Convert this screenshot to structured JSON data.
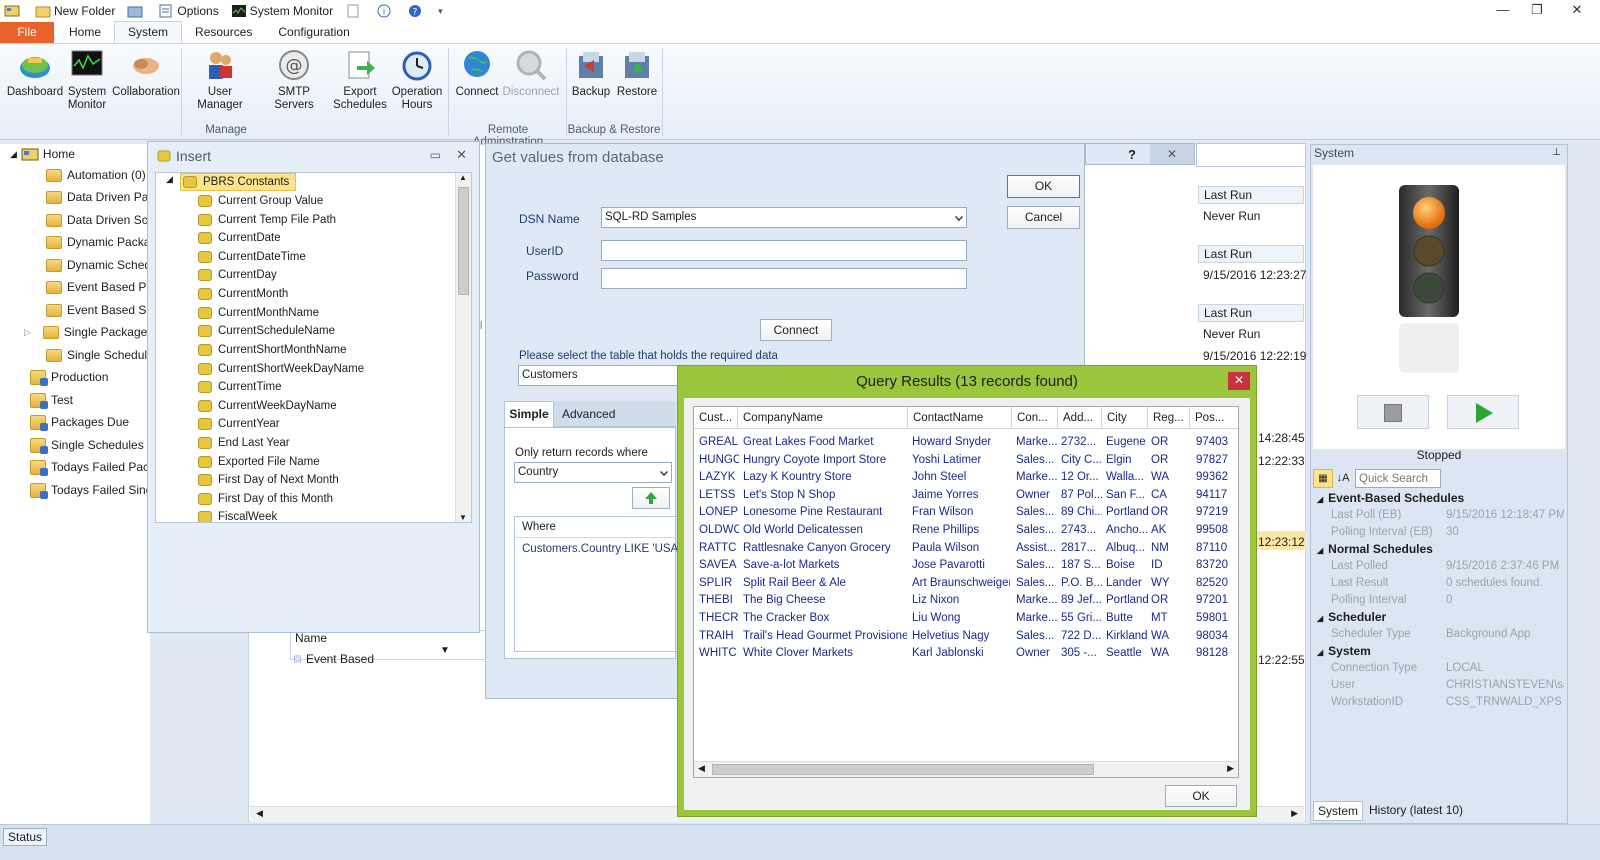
{
  "qat": {
    "new_folder": "New Folder",
    "options": "Options",
    "system_monitor": "System Monitor"
  },
  "tabs": [
    "File",
    "Home",
    "System",
    "Resources",
    "Configuration"
  ],
  "ribbon": {
    "buttons": [
      {
        "label": "Dashboard",
        "icon": "dashboard-icon"
      },
      {
        "label": "System\nMonitor",
        "icon": "system-monitor-icon"
      },
      {
        "label": "Collaboration",
        "icon": "collaboration-icon"
      },
      {
        "label": "User Manager",
        "icon": "user-manager-icon"
      },
      {
        "label": "SMTP Servers",
        "icon": "smtp-icon"
      },
      {
        "label": "Export\nSchedules",
        "icon": "export-icon"
      },
      {
        "label": "Operation\nHours",
        "icon": "clock-icon"
      },
      {
        "label": "Connect",
        "icon": "connect-icon"
      },
      {
        "label": "Disconnect",
        "icon": "disconnect-icon"
      },
      {
        "label": "Backup",
        "icon": "backup-icon"
      },
      {
        "label": "Restore",
        "icon": "restore-icon"
      }
    ],
    "groups": [
      "Manage",
      "Remote Adminstration",
      "Backup & Restore"
    ]
  },
  "tree": {
    "root": "Home",
    "items": [
      "Automation (0)",
      "Data Driven Pack",
      "Data Driven Sche",
      "Dynamic Packag",
      "Dynamic Schedu",
      "Event Based Pac",
      "Event Based Sch",
      "Single Packages",
      "Single Schedules",
      "Production",
      "Test",
      "Packages Due",
      "Single Schedules Du",
      "Todays Failed Packa",
      "Todays Failed Singl"
    ]
  },
  "insert": {
    "title": "Insert",
    "root": "PBRS Constants",
    "items": [
      "Current Group Value",
      "Current Temp File Path",
      "CurrentDate",
      "CurrentDateTime",
      "CurrentDay",
      "CurrentMonth",
      "CurrentMonthName",
      "CurrentScheduleName",
      "CurrentShortMonthName",
      "CurrentShortWeekDayName",
      "CurrentTime",
      "CurrentWeekDayName",
      "CurrentYear",
      "End Last Year",
      "Exported File Name",
      "First Day of Next Month",
      "First Day of this Month",
      "FiscalWeek"
    ]
  },
  "background": {
    "name_header": "Name",
    "event_based": "Event Based",
    "last_run_label": "Last Run",
    "never_run": "Never Run",
    "run1": "9/15/2016 12:23:27",
    "run2": "9/15/2016 12:22:19",
    "t1": "14:28:45",
    "t2": "12:22:33",
    "t3": "12:23:12",
    "t4": "12:22:55"
  },
  "getvals": {
    "title": "Get values from database",
    "dsn_label": "DSN Name",
    "dsn_value": "SQL-RD Samples",
    "userid_label": "UserID",
    "password_label": "Password",
    "ok": "OK",
    "cancel": "Cancel",
    "connect": "Connect",
    "table_prompt": "Please select the table that holds the required data",
    "table_value": "Customers",
    "tab_simple": "Simple",
    "tab_advanced": "Advanced",
    "only_return": "Only return records where",
    "field_value": "Country",
    "where_header": "Where",
    "where_value": "Customers.Country LIKE 'USA%'"
  },
  "query": {
    "title": "Query Results (13 records found)",
    "ok": "OK",
    "columns": [
      "Cust...",
      "CompanyName",
      "ContactName",
      "Con...",
      "Add...",
      "City",
      "Reg...",
      "Pos..."
    ],
    "rows": [
      [
        "GREAL",
        "Great Lakes Food Market",
        "Howard Snyder",
        "Marke...",
        "2732...",
        "Eugene",
        "OR",
        "97403"
      ],
      [
        "HUNGC",
        "Hungry Coyote Import Store",
        "Yoshi Latimer",
        "Sales...",
        "City C...",
        "Elgin",
        "OR",
        "97827"
      ],
      [
        "LAZYK",
        "Lazy K Kountry Store",
        "John Steel",
        "Marke...",
        "12 Or...",
        "Walla...",
        "WA",
        "99362"
      ],
      [
        "LETSS",
        "Let's Stop N Shop",
        "Jaime Yorres",
        "Owner",
        "87 Pol...",
        "San F...",
        "CA",
        "94117"
      ],
      [
        "LONEP",
        "Lonesome Pine Restaurant",
        "Fran Wilson",
        "Sales...",
        "89 Chi...",
        "Portland",
        "OR",
        "97219"
      ],
      [
        "OLDWO",
        "Old World Delicatessen",
        "Rene Phillips",
        "Sales...",
        "2743...",
        "Ancho...",
        "AK",
        "99508"
      ],
      [
        "RATTC",
        "Rattlesnake Canyon Grocery",
        "Paula Wilson",
        "Assist...",
        "2817...",
        "Albuq...",
        "NM",
        "87110"
      ],
      [
        "SAVEA",
        "Save-a-lot Markets",
        "Jose Pavarotti",
        "Sales...",
        "187 S...",
        "Boise",
        "ID",
        "83720"
      ],
      [
        "SPLIR",
        "Split Rail Beer & Ale",
        "Art Braunschweiger",
        "Sales...",
        "P.O. B...",
        "Lander",
        "WY",
        "82520"
      ],
      [
        "THEBI",
        "The Big Cheese",
        "Liz Nixon",
        "Marke...",
        "89 Jef...",
        "Portland",
        "OR",
        "97201"
      ],
      [
        "THECR",
        "The Cracker Box",
        "Liu Wong",
        "Marke...",
        "55 Gri...",
        "Butte",
        "MT",
        "59801"
      ],
      [
        "TRAIH",
        "Trail's Head Gourmet Provisioners",
        "Helvetius Nagy",
        "Sales...",
        "722 D...",
        "Kirkland",
        "WA",
        "98034"
      ],
      [
        "WHITC",
        "White Clover Markets",
        "Karl Jablonski",
        "Owner",
        "305 -...",
        "Seattle",
        "WA",
        "98128"
      ]
    ]
  },
  "system": {
    "title": "System",
    "status": "Stopped",
    "search_placeholder": "Quick Search",
    "sections": [
      {
        "name": "Event-Based Schedules",
        "props": [
          [
            "Last Poll (EB)",
            "9/15/2016 12:18:47 PM"
          ],
          [
            "Polling Interval (EB)",
            "30"
          ]
        ]
      },
      {
        "name": "Normal Schedules",
        "props": [
          [
            "Last Polled",
            "9/15/2016 2:37:46 PM"
          ],
          [
            "Last Result",
            "0 schedules found."
          ],
          [
            "Polling Interval",
            "0"
          ]
        ]
      },
      {
        "name": "Scheduler",
        "props": [
          [
            "Scheduler Type",
            "Background App"
          ]
        ]
      },
      {
        "name": "System",
        "props": [
          [
            "Connection Type",
            "LOCAL"
          ],
          [
            "User",
            "CHRISTIANSTEVEN\\sara"
          ],
          [
            "WorkstationID",
            "CSS_TRNWALD_XPS"
          ]
        ]
      }
    ],
    "bottom_tabs": [
      "System",
      "History (latest 10)"
    ]
  },
  "statusbar": {
    "label": "Status"
  }
}
